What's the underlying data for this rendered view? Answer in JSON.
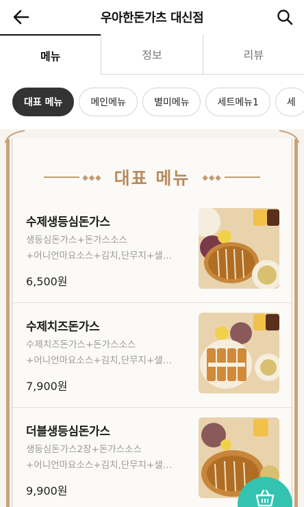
{
  "header": {
    "title": "우아한돈가츠 대신점"
  },
  "tabs": [
    {
      "label": "메뉴"
    },
    {
      "label": "정보"
    },
    {
      "label": "리뷰"
    }
  ],
  "chips": [
    {
      "label": "대표 메뉴"
    },
    {
      "label": "메인메뉴"
    },
    {
      "label": "별미메뉴"
    },
    {
      "label": "세트메뉴1"
    },
    {
      "label": "세"
    }
  ],
  "section": {
    "title": "대표 메뉴"
  },
  "items": [
    {
      "name": "수제생등심돈가스",
      "desc1": "생등심돈가스+돈가스소스",
      "desc2": "+어니언마요소스+김치,단무지+샐…",
      "price": "6,500원"
    },
    {
      "name": "수제치즈돈가스",
      "desc1": "수제치즈돈가스+돈가스소스",
      "desc2": "+어니언마요소스+김치,단무지+샐…",
      "price": "7,900원"
    },
    {
      "name": "더블생등심돈가스",
      "desc1": "생등심돈가스2장+돈가스소스",
      "desc2": "+어니언마요소스+김치,단무지+샐…",
      "price": "9,900원"
    }
  ],
  "colors": {
    "accent": "#b88a5b",
    "fab": "#33c3b0",
    "chip_active": "#333333"
  },
  "icons": {
    "back": "arrow-left-icon",
    "search": "search-icon",
    "cart": "basket-icon"
  }
}
